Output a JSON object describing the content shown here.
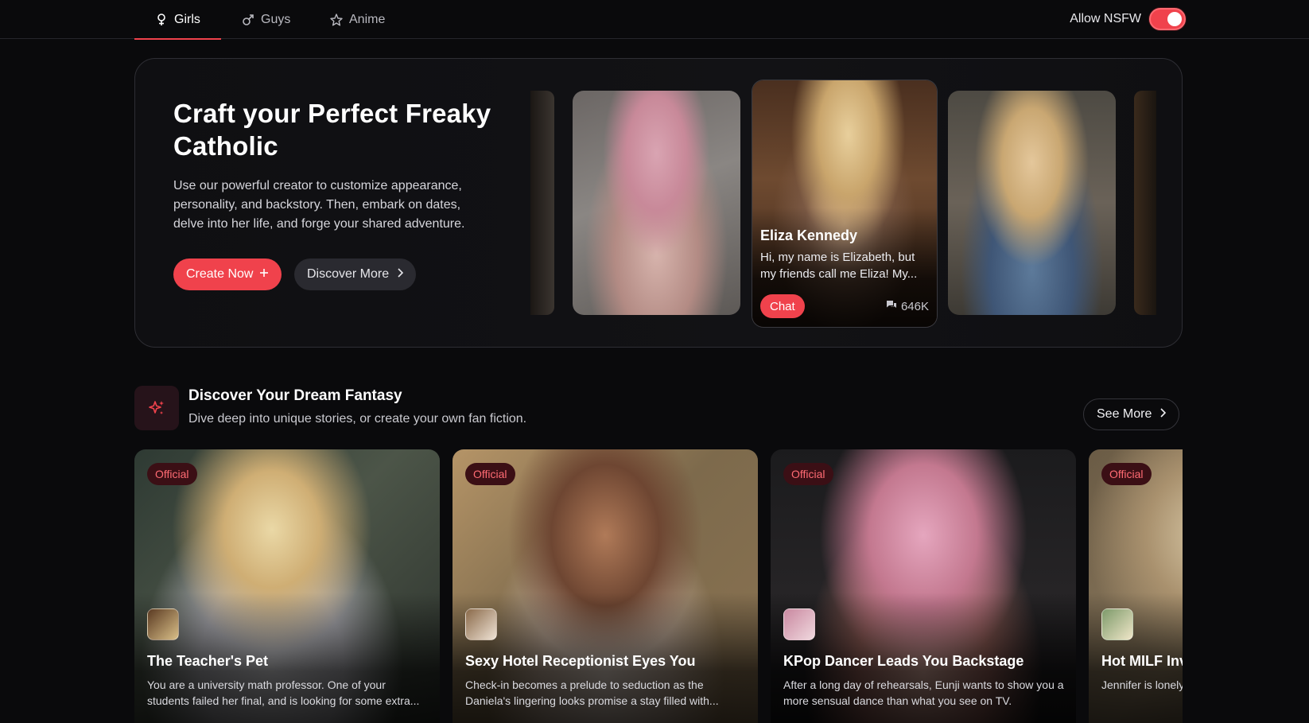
{
  "nav": {
    "tabs": [
      {
        "label": "Girls",
        "icon": "female-icon",
        "active": true
      },
      {
        "label": "Guys",
        "icon": "male-icon",
        "active": false
      },
      {
        "label": "Anime",
        "icon": "star-icon",
        "active": false
      }
    ],
    "nsfw_label": "Allow NSFW",
    "nsfw_enabled": true
  },
  "hero": {
    "title": "Craft your Perfect Freaky Catholic",
    "description": "Use our powerful creator to customize appearance, personality, and backstory. Then, embark on dates, delve into her life, and forge your shared adventure.",
    "create_label": "Create Now",
    "discover_label": "Discover More",
    "featured": {
      "name": "Eliza Kennedy",
      "description": "Hi, my name is Elizabeth, but my friends call me Eliza! My...",
      "chat_label": "Chat",
      "count": "646K"
    }
  },
  "section": {
    "title": "Discover Your Dream Fantasy",
    "subtitle": "Dive deep into unique stories, or create your own fan fiction.",
    "see_more_label": "See More"
  },
  "cards": [
    {
      "badge": "Official",
      "title": "The Teacher's Pet",
      "description": "You are a university math professor. One of your students failed her final, and is looking for some extra..."
    },
    {
      "badge": "Official",
      "title": "Sexy Hotel Receptionist Eyes You",
      "description": "Check-in becomes a prelude to seduction as the Daniela's lingering looks promise a stay filled with..."
    },
    {
      "badge": "Official",
      "title": "KPop Dancer Leads You Backstage",
      "description": "After a long day of rehearsals, Eunji wants to show you a more sensual dance than what you see on TV."
    },
    {
      "badge": "Official",
      "title": "Hot MILF Inv",
      "description": "Jennifer is lonely away. However,"
    }
  ],
  "colors": {
    "accent": "#f0424c",
    "background": "#0a0a0c",
    "badge_bg": "#3b0f15",
    "badge_text": "#ff6b73"
  }
}
